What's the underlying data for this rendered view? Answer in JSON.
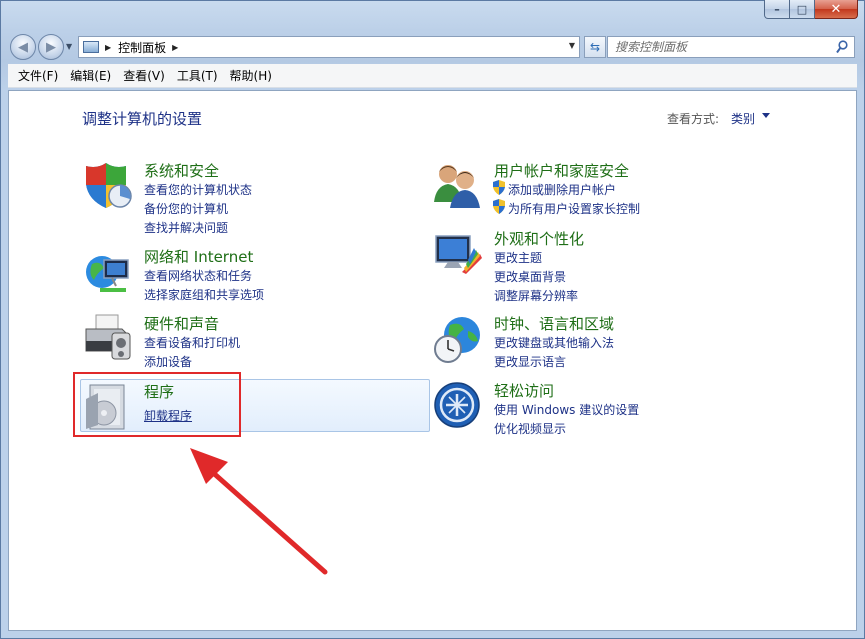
{
  "window": {
    "caption": {
      "minimize": "–",
      "maximize": "□",
      "close": "✕"
    }
  },
  "nav": {
    "back_icon": "back-arrow-icon",
    "forward_icon": "forward-arrow-icon",
    "address": "控制面板",
    "search_placeholder": "搜索控制面板"
  },
  "menu": [
    "文件(F)",
    "编辑(E)",
    "查看(V)",
    "工具(T)",
    "帮助(H)"
  ],
  "main": {
    "title": "调整计算机的设置",
    "view_by_label": "查看方式:",
    "view_by_value": "类别"
  },
  "categories": {
    "system": {
      "title": "系统和安全",
      "links": [
        "查看您的计算机状态",
        "备份您的计算机",
        "查找并解决问题"
      ]
    },
    "network": {
      "title": "网络和 Internet",
      "links": [
        "查看网络状态和任务",
        "选择家庭组和共享选项"
      ]
    },
    "hardware": {
      "title": "硬件和声音",
      "links": [
        "查看设备和打印机",
        "添加设备"
      ]
    },
    "programs": {
      "title": "程序",
      "links": [
        "卸载程序"
      ]
    },
    "users": {
      "title": "用户帐户和家庭安全",
      "links": [
        "添加或删除用户帐户",
        "为所有用户设置家长控制"
      ]
    },
    "appearance": {
      "title": "外观和个性化",
      "links": [
        "更改主题",
        "更改桌面背景",
        "调整屏幕分辨率"
      ]
    },
    "clock": {
      "title": "时钟、语言和区域",
      "links": [
        "更改键盘或其他输入法",
        "更改显示语言"
      ]
    },
    "access": {
      "title": "轻松访问",
      "links": [
        "使用 Windows 建议的设置",
        "优化视频显示"
      ]
    }
  },
  "annotation": {
    "color": "#e0292a"
  }
}
